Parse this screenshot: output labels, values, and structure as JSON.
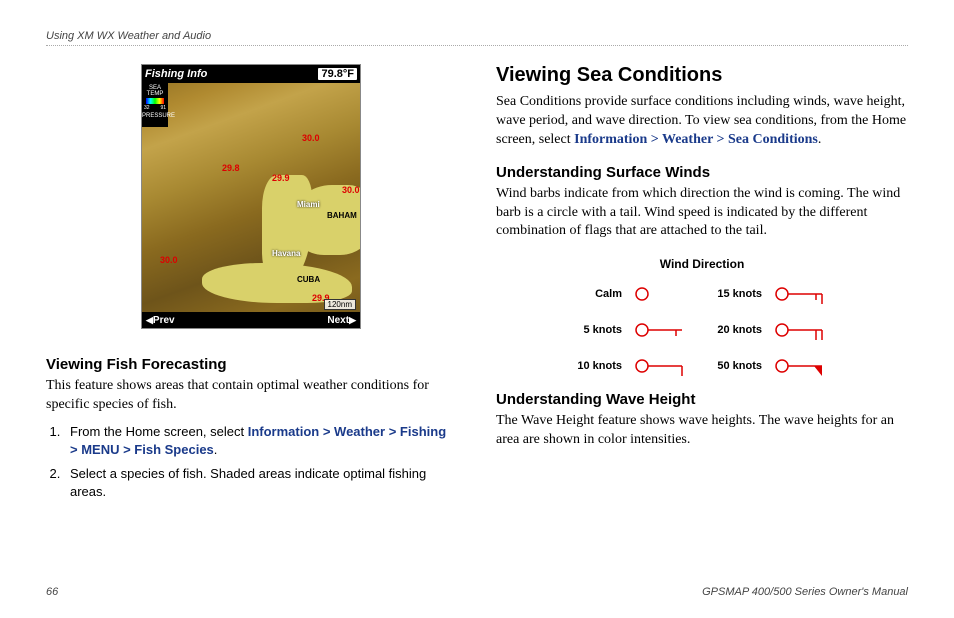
{
  "header": "Using XM WX Weather and Audio",
  "map": {
    "title": "Fishing Info",
    "temp": "79.8°F",
    "side_top": "SEA TEMP",
    "side_lo": "32",
    "side_hi": "91",
    "side_bot": "PRESSURE",
    "labels": {
      "miami": "Miami",
      "havana": "Havana",
      "baham": "BAHAM",
      "cuba": "CUBA"
    },
    "isobars": {
      "a": "30.0",
      "b": "29.8",
      "c": "29.9",
      "d": "30.0",
      "e": "29.9",
      "f": "30.0"
    },
    "scale": "120nm",
    "prev": "Prev",
    "next": "Next"
  },
  "left": {
    "h": "Viewing Fish Forecasting",
    "p": "This feature shows areas that contain optimal weather conditions for specific species of fish.",
    "step1_a": "From the Home screen, select ",
    "step1_nav": "Information > Weather > Fishing > MENU > Fish Species",
    "step1_b": ".",
    "step2": "Select a species of fish. Shaded areas indicate optimal fishing areas."
  },
  "right": {
    "h1": "Viewing Sea Conditions",
    "p1_a": "Sea Conditions provide surface conditions including winds, wave height, wave period, and wave direction. To view sea conditions, from the Home screen, select ",
    "p1_nav": "Information > Weather > Sea Conditions",
    "p1_b": ".",
    "h2": "Understanding Surface Winds",
    "p2": "Wind barbs indicate from which direction the wind is coming. The wind barb is a circle with a tail. Wind speed is indicated by the different combination of flags that are attached to the tail.",
    "wind_title": "Wind Direction",
    "wind_labels": {
      "calm": "Calm",
      "k5": "5 knots",
      "k10": "10 knots",
      "k15": "15 knots",
      "k20": "20 knots",
      "k50": "50 knots"
    },
    "h3": "Understanding Wave Height",
    "p3": "The Wave Height feature shows wave heights. The wave heights for an area are shown in color intensities."
  },
  "footer": {
    "page": "66",
    "manual": "GPSMAP 400/500 Series Owner's Manual"
  }
}
